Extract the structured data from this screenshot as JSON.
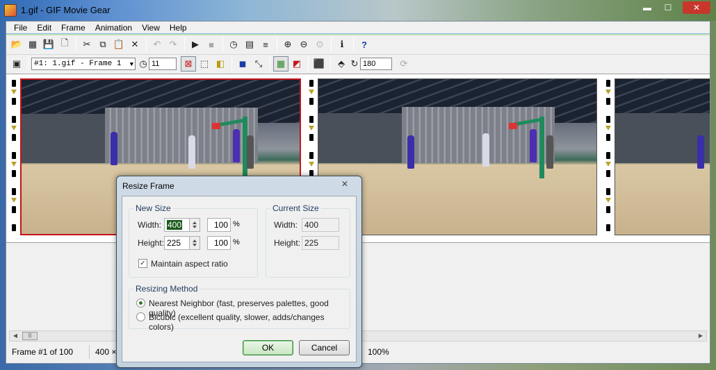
{
  "window": {
    "title": "1.gif - GIF Movie Gear",
    "controls": {
      "minimize": "▬",
      "maximize": "☐",
      "close": "✕"
    }
  },
  "menubar": {
    "items": [
      "File",
      "Edit",
      "Frame",
      "Animation",
      "View",
      "Help"
    ]
  },
  "toolbar1": {
    "icons": [
      "open-icon",
      "gif-icon",
      "save-icon",
      "new-icon",
      "cut-icon",
      "copy-icon",
      "paste-icon",
      "delete-icon",
      "undo-icon",
      "redo-icon",
      "play-icon",
      "stop-icon",
      "timing-icon",
      "filmstrip-icon",
      "trim-icon",
      "zoom-in-icon",
      "zoom-out-icon",
      "zoom-fit-icon",
      "info-icon",
      "help-icon"
    ]
  },
  "toolbar2": {
    "frame_select": "#1: 1.gif - Frame 1",
    "delay_value": "11",
    "rotate_value": "180"
  },
  "filmstrip": {
    "frame_count_visible": 3,
    "selected_frame": 1
  },
  "statusbar": {
    "frame_info": "Frame #1 of 100",
    "size_info": "400 ×",
    "zoom": "100%"
  },
  "dialog": {
    "title": "Resize Frame",
    "close": "✕",
    "new_size": {
      "label": "New Size",
      "width_label": "Width:",
      "width_value": "400",
      "width_pct": "100",
      "height_label": "Height:",
      "height_value": "225",
      "height_pct": "100",
      "pct_sign": "%",
      "maintain_label": "Maintain aspect ratio",
      "maintain_checked": true
    },
    "current_size": {
      "label": "Current Size",
      "width_label": "Width:",
      "width_value": "400",
      "height_label": "Height:",
      "height_value": "225"
    },
    "resizing_method": {
      "label": "Resizing Method",
      "options": [
        {
          "label": "Nearest Neighbor (fast, preserves palettes, good quality)",
          "checked": true
        },
        {
          "label": "Bicubic (excellent quality, slower, adds/changes colors)",
          "checked": false
        }
      ]
    },
    "ok_label": "OK",
    "cancel_label": "Cancel"
  }
}
